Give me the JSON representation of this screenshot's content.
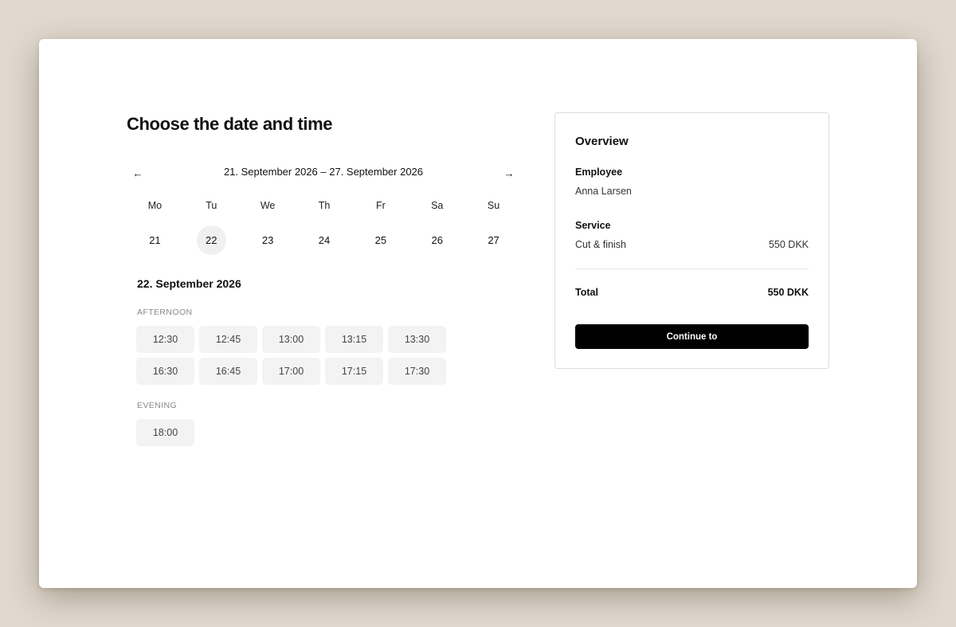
{
  "page": {
    "title": "Choose the date and time"
  },
  "calendar": {
    "week_range": "21. September 2026 – 27. September 2026",
    "prev_icon": "arrow-left-icon",
    "next_icon": "arrow-right-icon",
    "days": [
      {
        "dow": "Mo",
        "date": "21",
        "selected": false
      },
      {
        "dow": "Tu",
        "date": "22",
        "selected": true
      },
      {
        "dow": "We",
        "date": "23",
        "selected": false
      },
      {
        "dow": "Th",
        "date": "24",
        "selected": false
      },
      {
        "dow": "Fr",
        "date": "25",
        "selected": false
      },
      {
        "dow": "Sa",
        "date": "26",
        "selected": false
      },
      {
        "dow": "Su",
        "date": "27",
        "selected": false
      }
    ]
  },
  "selected_date": "22. September 2026",
  "timeslots": {
    "afternoon_label": "AFTERNOON",
    "afternoon": [
      "12:30",
      "12:45",
      "13:00",
      "13:15",
      "13:30",
      "16:30",
      "16:45",
      "17:00",
      "17:15",
      "17:30"
    ],
    "evening_label": "EVENING",
    "evening": [
      "18:00"
    ]
  },
  "overview": {
    "title": "Overview",
    "employee_label": "Employee",
    "employee_name": "Anna Larsen",
    "service_label": "Service",
    "service_name": "Cut & finish",
    "service_price": "550 DKK",
    "total_label": "Total",
    "total_value": "550 DKK",
    "continue_label": "Continue to"
  },
  "colors": {
    "background": "#e1d9ce",
    "card": "#ffffff",
    "slot_bg": "#f3f3f3",
    "button": "#000000"
  }
}
